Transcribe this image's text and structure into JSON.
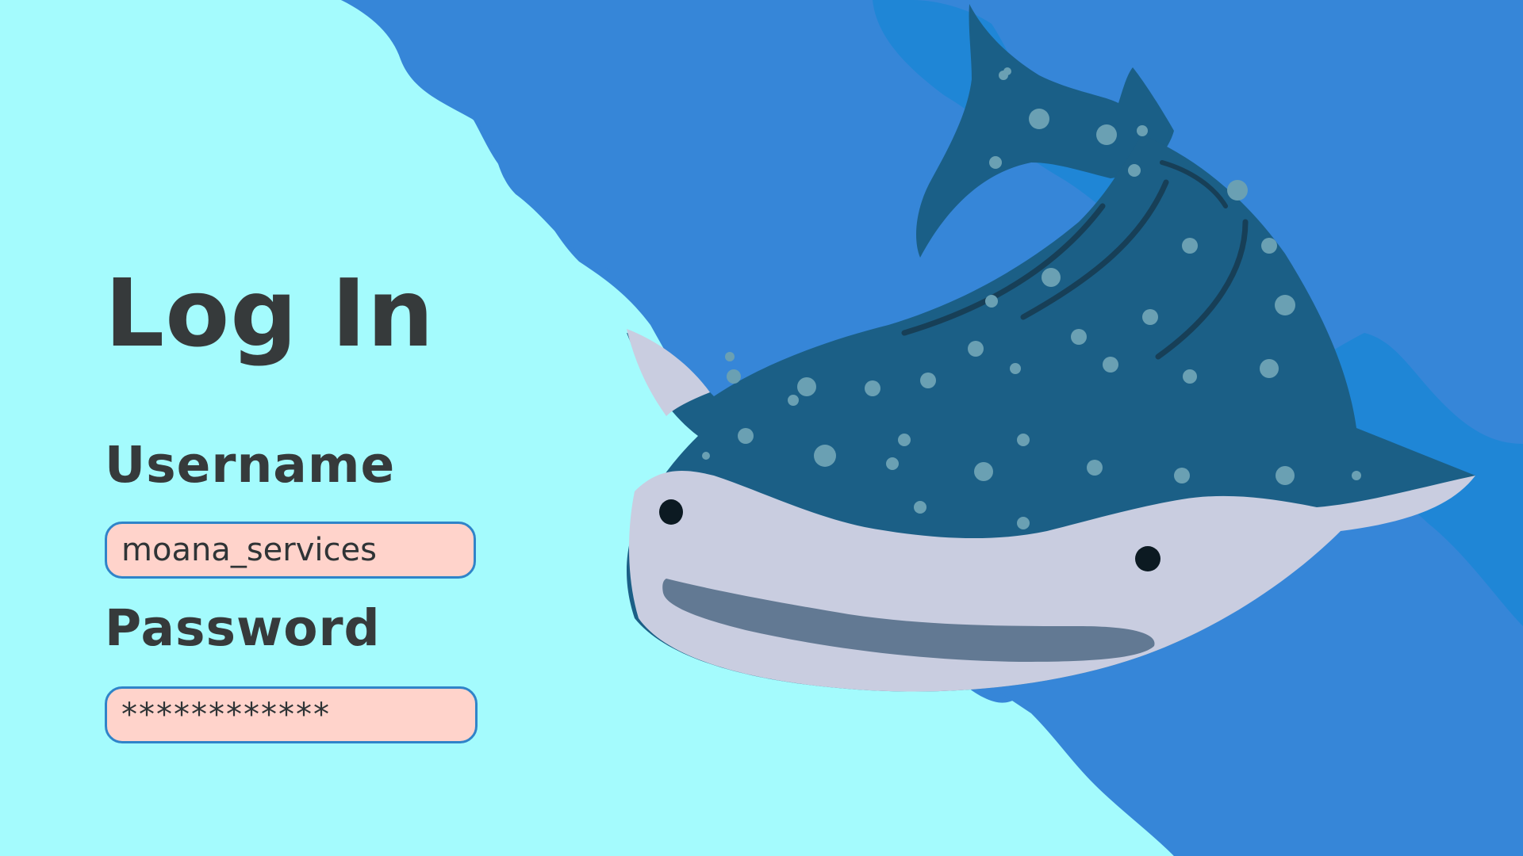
{
  "login": {
    "title": "Log In",
    "username_label": "Username",
    "username_value": "moana_services",
    "password_label": "Password",
    "password_value": "************"
  },
  "illustration": {
    "icon": "whale-shark-illustration"
  },
  "colors": {
    "background": "#a4fbfd",
    "ocean": "#3686d8",
    "field_fill": "#ffd3cb",
    "field_border": "#2f84c9",
    "text": "#363a3b"
  }
}
